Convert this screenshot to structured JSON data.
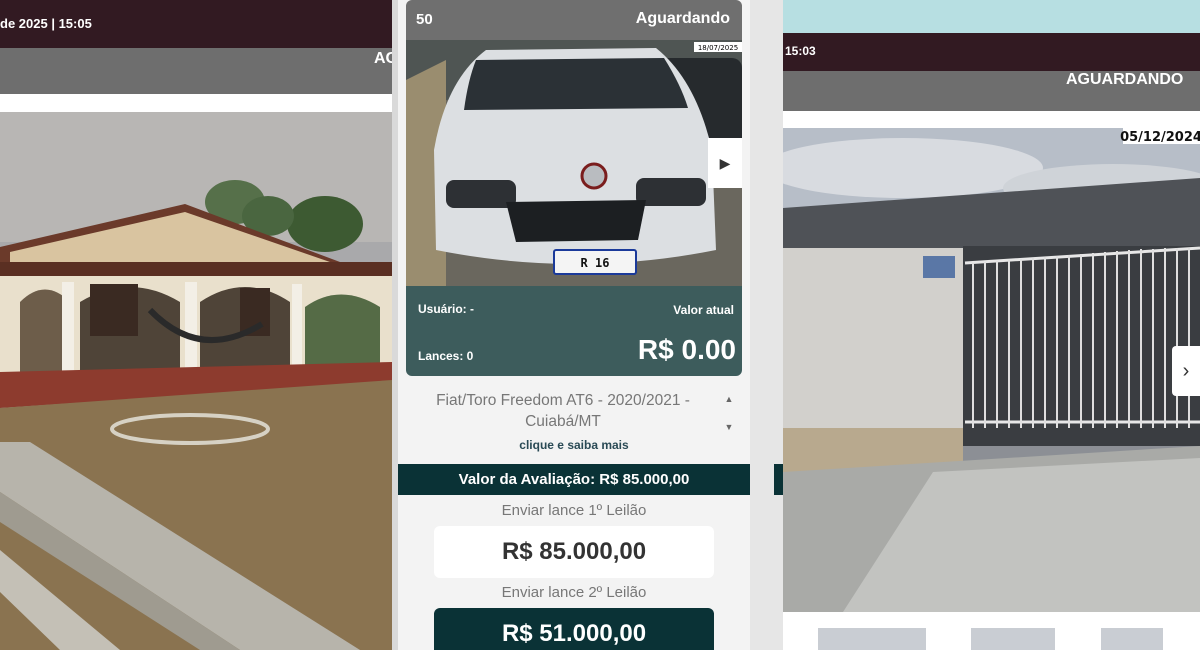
{
  "left_card": {
    "datetime_fragment": "de 2025 | 15:05",
    "status_fragment": "AG"
  },
  "center_card": {
    "lot_number": "50",
    "status": "Aguardando",
    "photo_date": "18/07/2025",
    "plate": "R      16",
    "next_icon": "play-triangle",
    "user_label": "Usuário: -",
    "current_value_label": "Valor atual",
    "bids_label": "Lances: 0",
    "current_value": "R$ 0.00",
    "description_line1": "Fiat/Toro Freedom AT6 - 2020/2021 -",
    "description_line2": "Cuiabá/MT",
    "more_link": "clique e saiba mais",
    "evaluation": "Valor da Avaliação: R$ 85.000,00",
    "first_auction_label": "Enviar lance 1º Leilão",
    "first_auction_amount": "R$ 85.000,00",
    "second_auction_label": "Enviar lance 2º Leilão",
    "second_auction_amount": "R$ 51.000,00"
  },
  "right_card": {
    "time_fragment": "15:03",
    "status": "AGUARDANDO",
    "photo_date": "05/12/2024",
    "arrow_glyph": "›"
  },
  "colors": {
    "header_dark": "#321a22",
    "status_gray": "#6e6e6e",
    "bid_panel": "#3d5c5c",
    "dark_teal": "#0a3236",
    "light_band": "#b7dfe2"
  }
}
